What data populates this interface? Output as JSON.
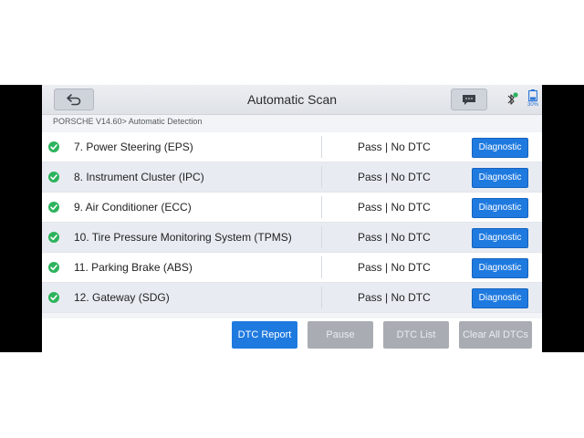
{
  "header": {
    "title": "Automatic Scan",
    "battery_text": "30%"
  },
  "breadcrumb": "PORSCHE V14.60> Automatic Detection",
  "rows": [
    {
      "name": "7. Power Steering (EPS)",
      "status": "Pass | No DTC",
      "action": "Diagnostic"
    },
    {
      "name": "8. Instrument Cluster (IPC)",
      "status": "Pass | No DTC",
      "action": "Diagnostic"
    },
    {
      "name": "9. Air Conditioner (ECC)",
      "status": "Pass | No DTC",
      "action": "Diagnostic"
    },
    {
      "name": "10. Tire Pressure Monitoring System (TPMS)",
      "status": "Pass | No DTC",
      "action": "Diagnostic"
    },
    {
      "name": "11. Parking Brake (ABS)",
      "status": "Pass | No DTC",
      "action": "Diagnostic"
    },
    {
      "name": "12. Gateway (SDG)",
      "status": "Pass | No DTC",
      "action": "Diagnostic"
    }
  ],
  "footer": {
    "dtc_report": "DTC Report",
    "pause": "Pause",
    "dtc_list": "DTC List",
    "clear_all": "Clear All DTCs"
  },
  "colors": {
    "accent": "#1f7ae0",
    "pass": "#2db35d",
    "disabled": "#a9adb3"
  },
  "icons": {
    "back": "back-arrow-icon",
    "message": "message-icon",
    "bluetooth": "bluetooth-icon",
    "battery": "battery-icon",
    "status": "check-circle-icon"
  }
}
